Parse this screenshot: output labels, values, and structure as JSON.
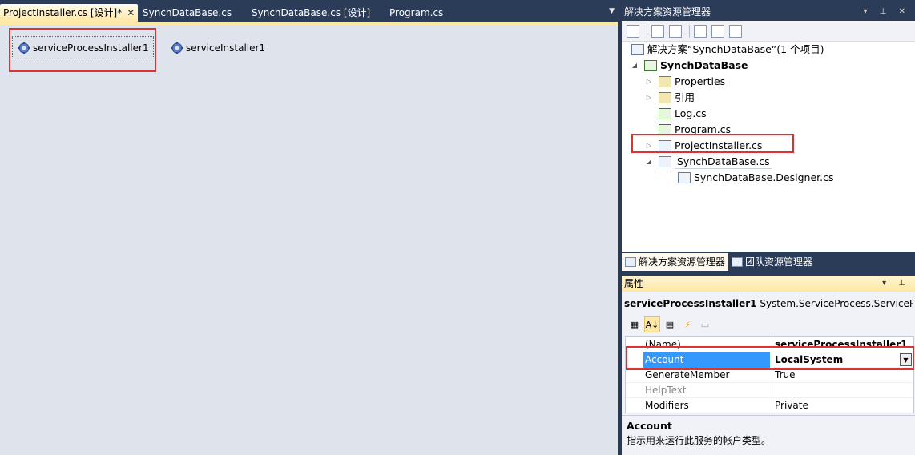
{
  "editor": {
    "tabs": [
      {
        "label": "ProjectInstaller.cs [设计]*",
        "active": true
      },
      {
        "label": "SynchDataBase.cs",
        "active": false
      },
      {
        "label": "SynchDataBase.cs [设计]",
        "active": false
      },
      {
        "label": "Program.cs",
        "active": false
      }
    ],
    "close_glyph": "✕",
    "dropdown_glyph": "▼",
    "components": [
      {
        "label": "serviceProcessInstaller1",
        "icon": "gear-icon",
        "selected": true
      },
      {
        "label": "serviceInstaller1",
        "icon": "gear-icon",
        "selected": false
      }
    ]
  },
  "solution_explorer": {
    "title": "解决方案资源管理器",
    "pin_glyphs": "▾ ⊥ ✕",
    "tree": {
      "solution": "解决方案“SynchDataBase”(1 个项目)",
      "project": "SynchDataBase",
      "items": [
        {
          "label": "Properties",
          "icon": "properties-folder-icon",
          "expander": "▷"
        },
        {
          "label": "引用",
          "icon": "references-icon",
          "expander": "▷"
        },
        {
          "label": "Log.cs",
          "icon": "csharp-file-icon",
          "expander": ""
        },
        {
          "label": "Program.cs",
          "icon": "csharp-file-icon",
          "expander": ""
        },
        {
          "label": "ProjectInstaller.cs",
          "icon": "component-file-icon",
          "expander": "▷"
        },
        {
          "label": "SynchDataBase.cs",
          "icon": "component-file-icon",
          "expander": "◢"
        },
        {
          "label": "SynchDataBase.Designer.cs",
          "icon": "designer-file-icon",
          "expander": ""
        }
      ]
    },
    "bottom_tabs": [
      {
        "label": "解决方案资源管理器",
        "active": true
      },
      {
        "label": "团队资源管理器",
        "active": false
      }
    ]
  },
  "properties": {
    "title": "属性",
    "pin_glyphs": "▾ ⊥",
    "object_name": "serviceProcessInstaller1",
    "object_type": "System.ServiceProcess.ServiceProce",
    "rows": [
      {
        "name": "(Name)",
        "value": "serviceProcessInstaller1",
        "bold": true
      },
      {
        "name": "Account",
        "value": "LocalSystem",
        "bold": true,
        "selected": true
      },
      {
        "name": "GenerateMember",
        "value": "True"
      },
      {
        "name": "HelpText",
        "value": "",
        "gray": true
      },
      {
        "name": "Modifiers",
        "value": "Private"
      }
    ],
    "dropdown_glyph": "▼",
    "description": {
      "title": "Account",
      "text": "指示用来运行此服务的帐户类型。"
    }
  },
  "colors": {
    "highlight_red": "#e03030",
    "selection_blue": "#3399ff",
    "frame_navy": "#2b3c59"
  }
}
